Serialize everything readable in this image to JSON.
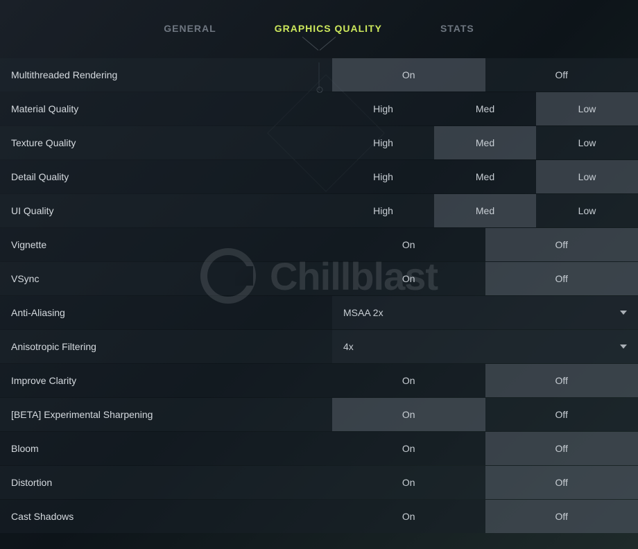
{
  "tabs": {
    "general": "GENERAL",
    "graphics": "GRAPHICS QUALITY",
    "stats": "STATS",
    "active": "graphics"
  },
  "watermark": "Chillblast",
  "options": {
    "on": "On",
    "off": "Off",
    "high": "High",
    "med": "Med",
    "low": "Low"
  },
  "settings": {
    "multithreaded_rendering": {
      "label": "Multithreaded Rendering",
      "type": "onoff",
      "value": "On"
    },
    "material_quality": {
      "label": "Material Quality",
      "type": "hml",
      "value": "Low"
    },
    "texture_quality": {
      "label": "Texture Quality",
      "type": "hml",
      "value": "Med"
    },
    "detail_quality": {
      "label": "Detail Quality",
      "type": "hml",
      "value": "Low"
    },
    "ui_quality": {
      "label": "UI Quality",
      "type": "hml",
      "value": "Med"
    },
    "vignette": {
      "label": "Vignette",
      "type": "onoff",
      "value": "Off"
    },
    "vsync": {
      "label": "VSync",
      "type": "onoff",
      "value": "Off"
    },
    "anti_aliasing": {
      "label": "Anti-Aliasing",
      "type": "dropdown",
      "value": "MSAA 2x"
    },
    "anisotropic_filtering": {
      "label": "Anisotropic Filtering",
      "type": "dropdown",
      "value": "4x"
    },
    "improve_clarity": {
      "label": "Improve Clarity",
      "type": "onoff",
      "value": "Off"
    },
    "beta_sharpening": {
      "label": "[BETA] Experimental Sharpening",
      "type": "onoff",
      "value": "On"
    },
    "bloom": {
      "label": "Bloom",
      "type": "onoff",
      "value": "Off"
    },
    "distortion": {
      "label": "Distortion",
      "type": "onoff",
      "value": "Off"
    },
    "cast_shadows": {
      "label": "Cast Shadows",
      "type": "onoff",
      "value": "Off"
    }
  },
  "order": [
    "multithreaded_rendering",
    "material_quality",
    "texture_quality",
    "detail_quality",
    "ui_quality",
    "vignette",
    "vsync",
    "anti_aliasing",
    "anisotropic_filtering",
    "improve_clarity",
    "beta_sharpening",
    "bloom",
    "distortion",
    "cast_shadows"
  ]
}
